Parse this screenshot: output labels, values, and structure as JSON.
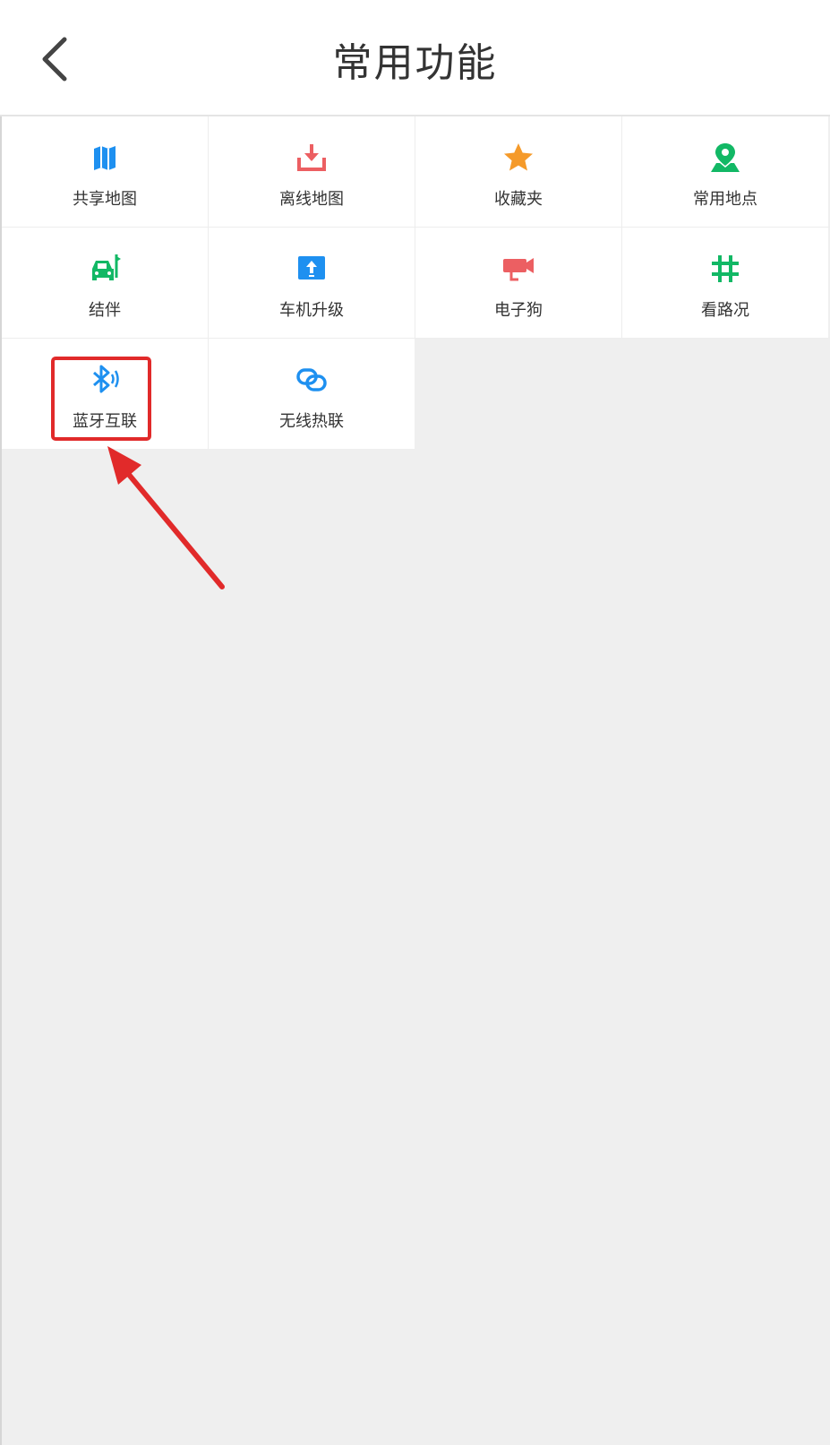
{
  "header": {
    "title": "常用功能",
    "back_icon": "chevron-left-icon"
  },
  "features": [
    {
      "label": "共享地图",
      "icon": "map-icon",
      "color": "#1e90f0"
    },
    {
      "label": "离线地图",
      "icon": "download-icon",
      "color": "#ec5f62"
    },
    {
      "label": "收藏夹",
      "icon": "star-icon",
      "color": "#f59a2a"
    },
    {
      "label": "常用地点",
      "icon": "location-pin-icon",
      "color": "#12b865"
    },
    {
      "label": "结伴",
      "icon": "car-icon",
      "color": "#12b865",
      "badge": "dot"
    },
    {
      "label": "车机升级",
      "icon": "upgrade-icon",
      "color": "#1e90f0"
    },
    {
      "label": "电子狗",
      "icon": "camera-icon",
      "color": "#ec5f62"
    },
    {
      "label": "看路况",
      "icon": "hash-icon",
      "color": "#12b865"
    },
    {
      "label": "蓝牙互联",
      "icon": "bluetooth-icon",
      "color": "#1e90f0",
      "highlighted": true
    },
    {
      "label": "无线热联",
      "icon": "wireless-link-icon",
      "color": "#1e90f0"
    }
  ],
  "colors": {
    "background": "#efefef",
    "highlight": "#e12a2a"
  }
}
